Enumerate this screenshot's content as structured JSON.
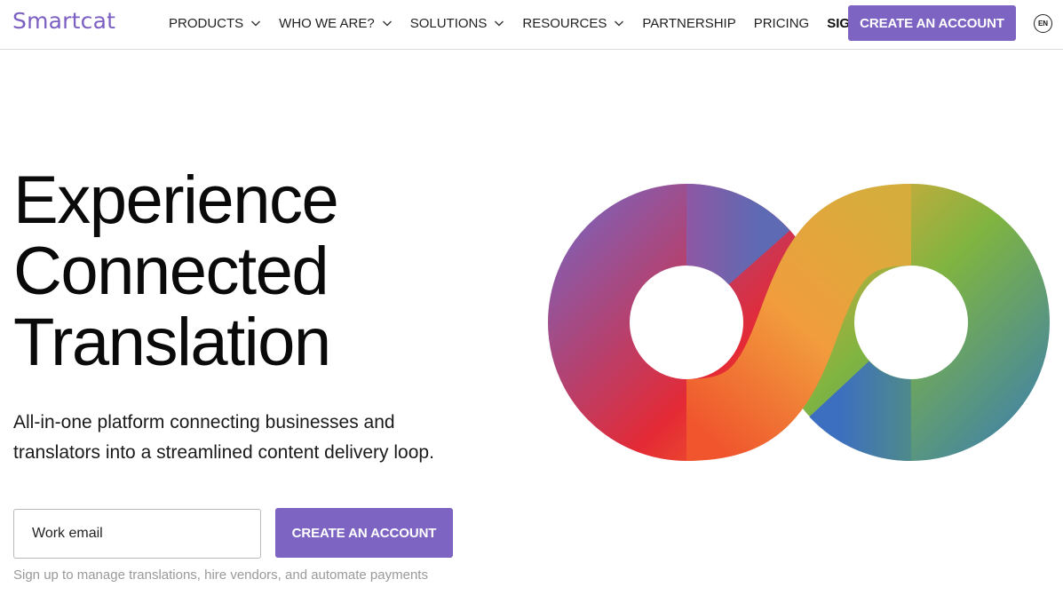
{
  "header": {
    "logo": "Smartcat",
    "nav": [
      {
        "label": "PRODUCTS",
        "has_dropdown": true
      },
      {
        "label": "WHO WE ARE?",
        "has_dropdown": true
      },
      {
        "label": "SOLUTIONS",
        "has_dropdown": true
      },
      {
        "label": "RESOURCES",
        "has_dropdown": true
      },
      {
        "label": "PARTNERSHIP",
        "has_dropdown": false
      },
      {
        "label": "PRICING",
        "has_dropdown": false
      }
    ],
    "sign_in": "SIGN IN",
    "create_account": "CREATE AN ACCOUNT",
    "language": "EN"
  },
  "hero": {
    "headline": [
      "Experience",
      "Connected",
      "Translation"
    ],
    "subtitle_lines": [
      "All-in-one platform connecting businesses and",
      "translators into a streamlined content delivery loop."
    ],
    "email_placeholder": "Work email",
    "cta": "CREATE AN ACCOUNT",
    "note": "Sign up to manage translations, hire vendors, and automate payments"
  },
  "colors": {
    "brand": "#7d63c2",
    "logo": "#7b5fc2"
  },
  "icons": {
    "dropdown": "chevron-down-icon",
    "language": "language-icon",
    "hero_graphic": "infinity-loop-graphic"
  }
}
